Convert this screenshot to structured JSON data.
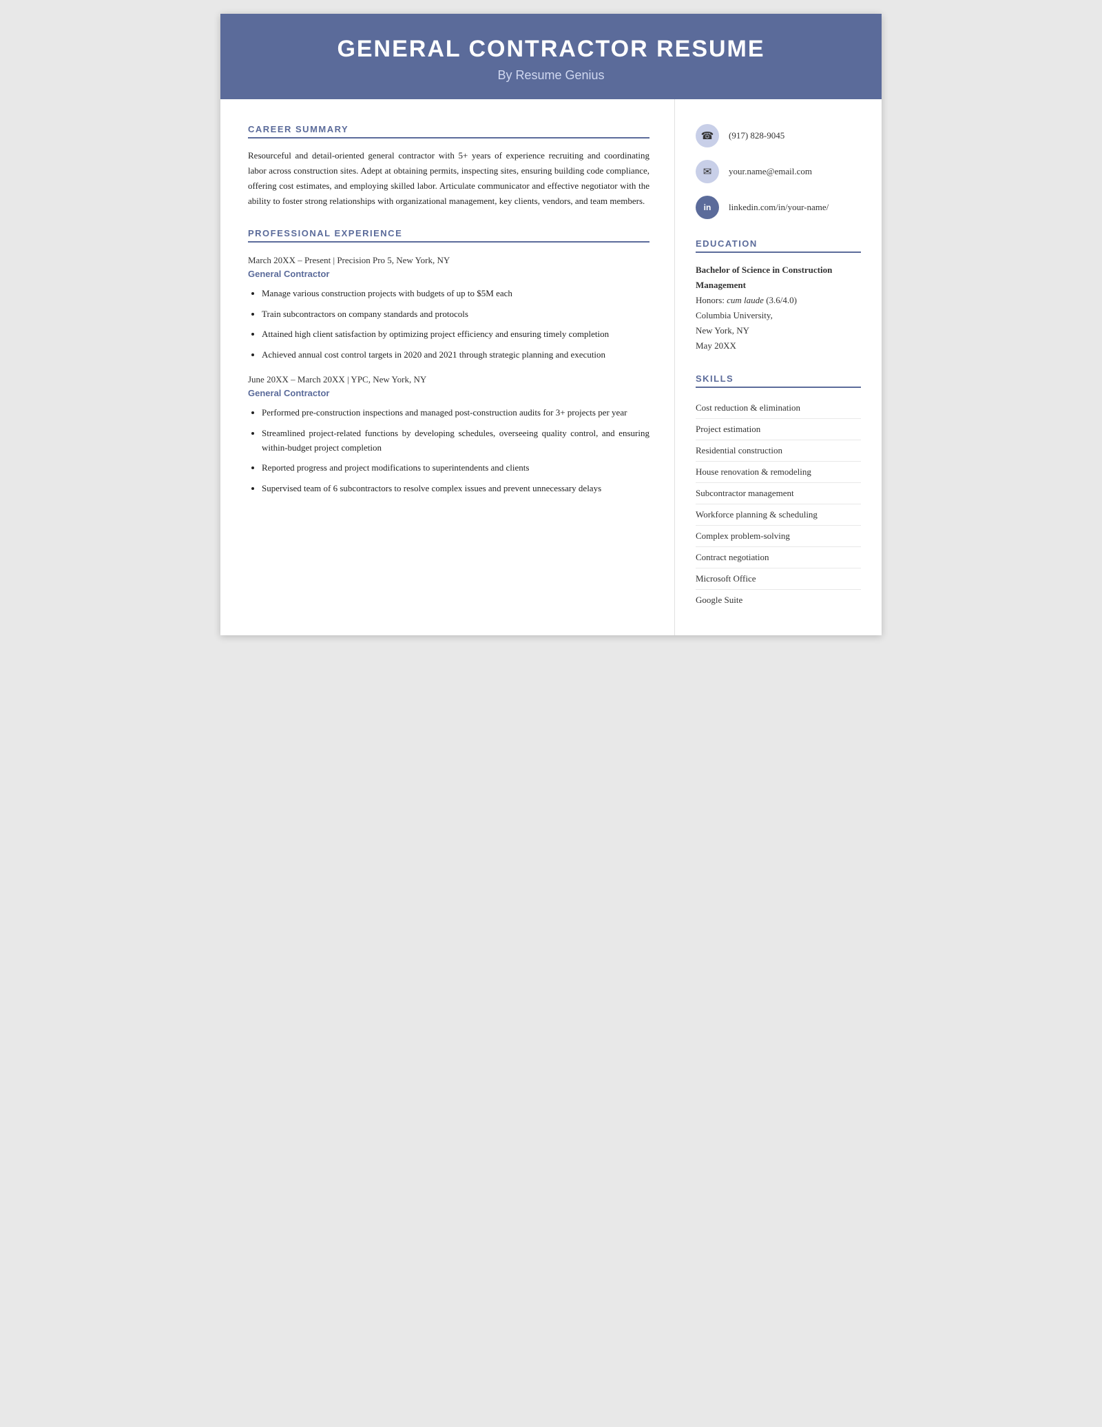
{
  "header": {
    "title": "GENERAL CONTRACTOR RESUME",
    "subtitle": "By Resume Genius"
  },
  "contact": {
    "phone": "(917) 828-9045",
    "email": "your.name@email.com",
    "linkedin": "linkedin.com/in/your-name/"
  },
  "career_summary": {
    "section_title": "CAREER SUMMARY",
    "text": "Resourceful and detail-oriented general contractor with 5+ years of experience recruiting and coordinating labor across construction sites. Adept at obtaining permits, inspecting sites, ensuring building code compliance, offering cost estimates, and employing skilled labor. Articulate communicator and effective negotiator with the ability to foster strong relationships with organizational management, key clients, vendors, and team members."
  },
  "professional_experience": {
    "section_title": "PROFESSIONAL EXPERIENCE",
    "jobs": [
      {
        "date_location": "March 20XX – Present | Precision Pro 5, New York, NY",
        "title": "General Contractor",
        "bullets": [
          "Manage various construction projects with budgets of up to $5M each",
          "Train subcontractors on company standards and protocols",
          "Attained high client satisfaction by optimizing project efficiency and ensuring timely completion",
          "Achieved annual cost control targets in 2020 and 2021 through strategic planning and execution"
        ]
      },
      {
        "date_location": "June 20XX – March 20XX | YPC, New York, NY",
        "title": "General Contractor",
        "bullets": [
          "Performed pre-construction inspections and managed post-construction audits for 3+ projects per year",
          "Streamlined project-related functions by developing schedules, overseeing quality control, and ensuring within-budget project completion",
          "Reported progress and project modifications to superintendents and clients",
          "Supervised team of 6 subcontractors to resolve complex issues and prevent unnecessary delays"
        ]
      }
    ]
  },
  "education": {
    "section_title": "EDUCATION",
    "degree": "Bachelor of Science in Construction Management",
    "honors_label": "Honors:",
    "honors_value": "cum laude",
    "honors_gpa": "(3.6/4.0)",
    "university": "Columbia University,",
    "location": "New York, NY",
    "date": "May 20XX"
  },
  "skills": {
    "section_title": "SKILLS",
    "items": [
      "Cost reduction & elimination",
      "Project estimation",
      "Residential construction",
      "House renovation & remodeling",
      "Subcontractor management",
      "Workforce planning & scheduling",
      "Complex problem-solving",
      "Contract negotiation",
      "Microsoft Office",
      "Google Suite"
    ]
  }
}
